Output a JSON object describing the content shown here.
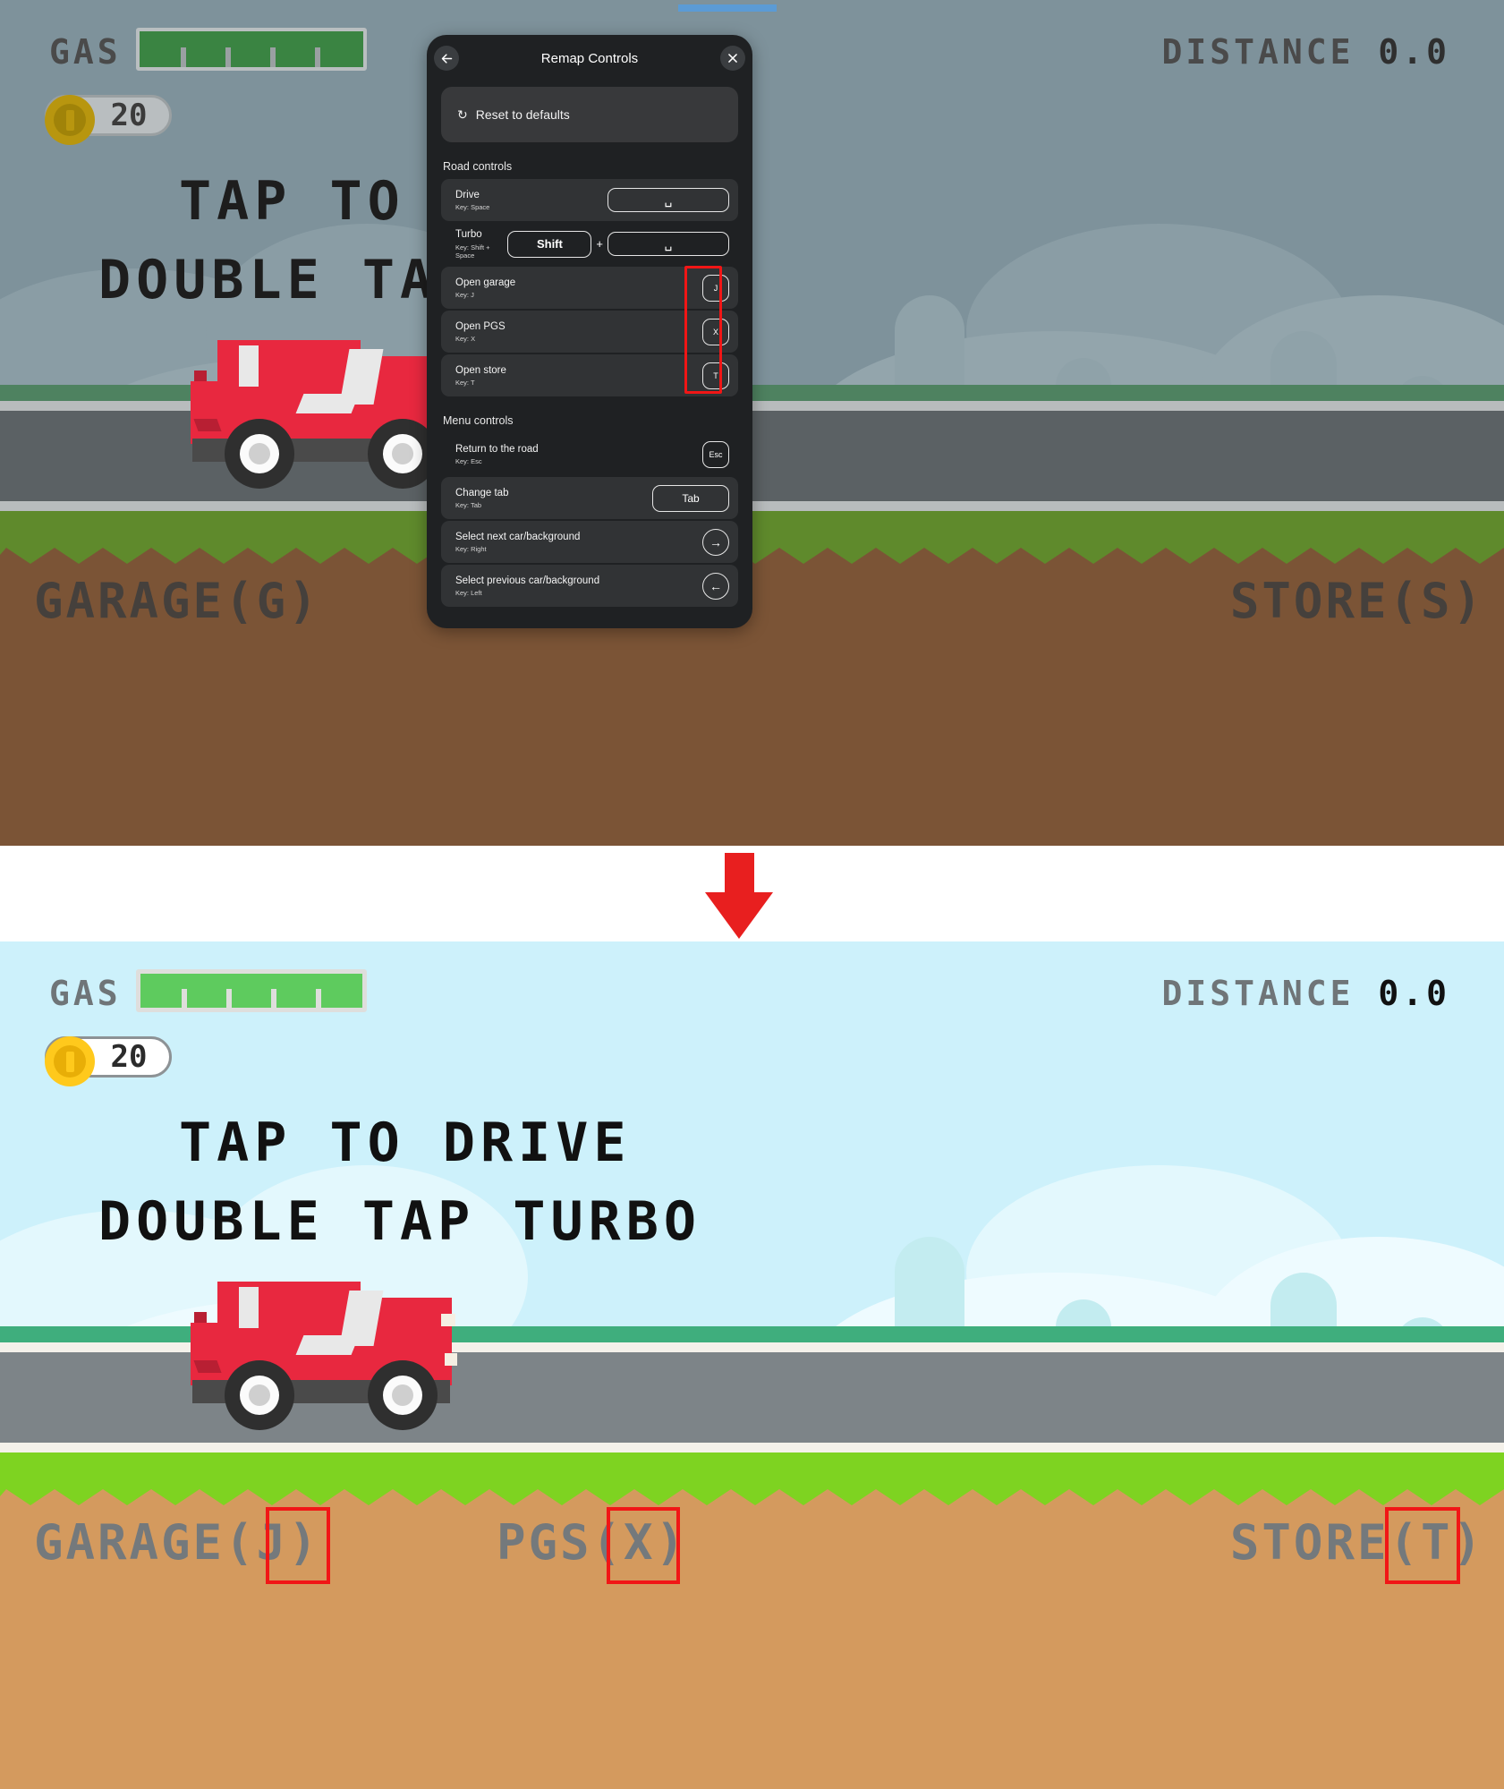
{
  "game": {
    "hud": {
      "gas_label": "GAS",
      "gas_percent": 100,
      "coins": "20",
      "distance_label": "DISTANCE",
      "distance_value": "0.0"
    },
    "prompts": {
      "line1": "TAP TO DRIVE",
      "line2": "DOUBLE TAP TURBO"
    },
    "nav_before": {
      "garage": "GARAGE(G)",
      "store": "STORE(S)"
    },
    "nav_after": {
      "garage": "GARAGE(J)",
      "pgs": "PGS(X)",
      "store": "STORE(T)"
    },
    "colors": {
      "highlight": "#f11616",
      "arrow": "#e81f1f",
      "gas_fill_before": "#3a8442",
      "gas_fill_after": "#5ecb5e",
      "sky_before": "#7e929b",
      "sky_after": "#cdf1fb"
    }
  },
  "dialog": {
    "title": "Remap Controls",
    "back_icon": "arrow-left-icon",
    "close_icon": "close-icon",
    "reset": {
      "icon": "reset-icon",
      "label": "Reset to defaults"
    },
    "sections": [
      {
        "title": "Road controls",
        "rows": [
          {
            "name": "Drive",
            "key_text": "Key: Space",
            "keys": [
              "␣"
            ],
            "key_style": "wide",
            "highlighted": false
          },
          {
            "name": "Turbo",
            "key_text": "Key: Shift + Space",
            "keys": [
              "Shift",
              "+",
              "␣"
            ],
            "key_style": "combo",
            "highlighted": false
          },
          {
            "name": "Open garage",
            "key_text": "Key: J",
            "keys": [
              "J"
            ],
            "key_style": "sq",
            "highlighted": true
          },
          {
            "name": "Open PGS",
            "key_text": "Key: X",
            "keys": [
              "X"
            ],
            "key_style": "sq",
            "highlighted": true
          },
          {
            "name": "Open store",
            "key_text": "Key: T",
            "keys": [
              "T"
            ],
            "key_style": "sq",
            "highlighted": true
          }
        ]
      },
      {
        "title": "Menu controls",
        "rows": [
          {
            "name": "Return to the road",
            "key_text": "Key: Esc",
            "keys": [
              "Esc"
            ],
            "key_style": "sq",
            "highlighted": false
          },
          {
            "name": "Change tab",
            "key_text": "Key: Tab",
            "keys": [
              "Tab"
            ],
            "key_style": "tab",
            "highlighted": false
          },
          {
            "name": "Select next car/background",
            "key_text": "Key: Right",
            "keys": [
              "→"
            ],
            "key_style": "sq",
            "highlighted": false
          },
          {
            "name": "Select previous car/background",
            "key_text": "Key: Left",
            "keys": [
              "←"
            ],
            "key_style": "sq",
            "highlighted": false
          }
        ]
      }
    ]
  }
}
